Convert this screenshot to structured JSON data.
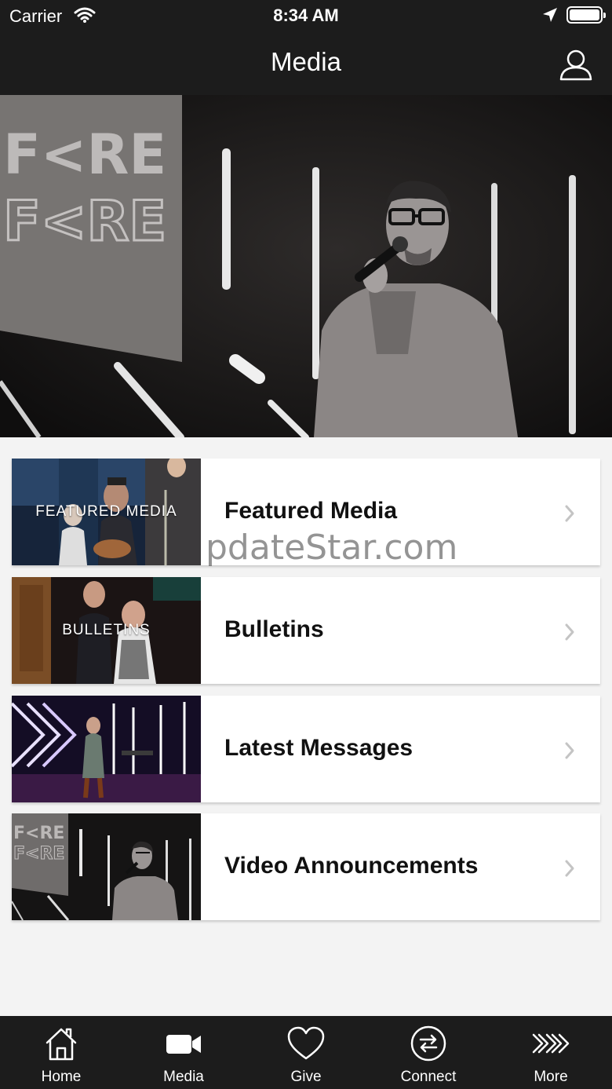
{
  "status_bar": {
    "carrier": "Carrier",
    "time": "8:34 AM"
  },
  "nav": {
    "title": "Media"
  },
  "rows": [
    {
      "thumb_label": "FEATURED MEDIA",
      "label": "Featured Media"
    },
    {
      "thumb_label": "BULLETINS",
      "label": "Bulletins"
    },
    {
      "thumb_label": "",
      "label": "Latest Messages"
    },
    {
      "thumb_label": "",
      "label": "Video Announcements"
    }
  ],
  "watermark": "pdateStar.com",
  "tabs": [
    {
      "label": "Home",
      "icon": "home-icon"
    },
    {
      "label": "Media",
      "icon": "video-camera-icon"
    },
    {
      "label": "Give",
      "icon": "heart-icon"
    },
    {
      "label": "Connect",
      "icon": "connect-arrows-icon"
    },
    {
      "label": "More",
      "icon": "chevrons-right-icon"
    }
  ],
  "colors": {
    "bar_background": "#1c1c1c",
    "page_background": "#f3f3f3",
    "row_background": "#ffffff"
  }
}
